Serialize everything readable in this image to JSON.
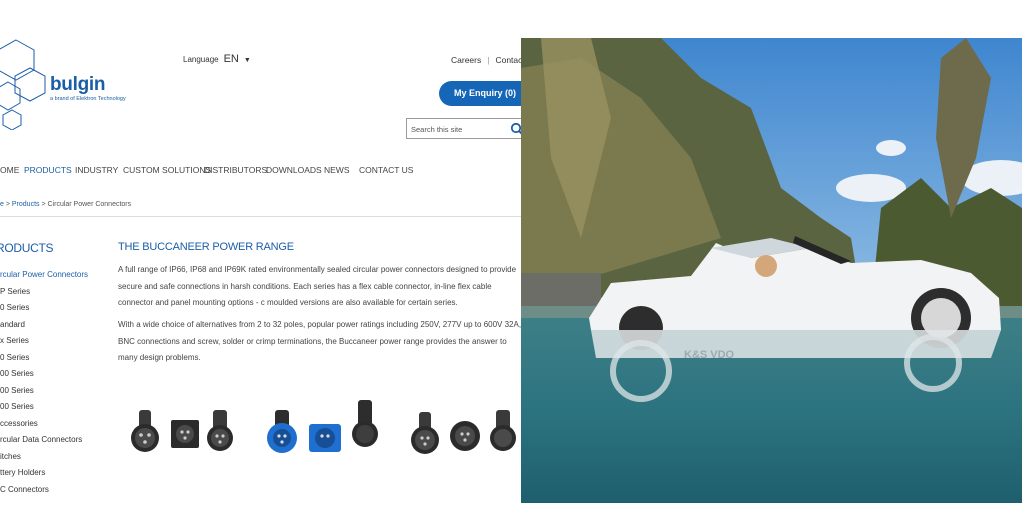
{
  "site": {
    "brand": {
      "name": "bulgin",
      "tagline": "a brand of Elektron Technology"
    },
    "language": {
      "label": "Language",
      "code": "EN"
    },
    "top_links": [
      "Careers",
      "Contact U"
    ],
    "enquiry_button": "My Enquiry (0)",
    "search_placeholder": "Search this site",
    "nav": [
      "OME",
      "PRODUCTS",
      "INDUSTRY",
      "CUSTOM SOLUTIONS",
      "DISTRIBUTORS",
      "DOWNLOADS",
      "NEWS",
      "CONTACT US"
    ],
    "nav_active_index": 1,
    "breadcrumb": {
      "home": "e",
      "sep1": " > ",
      "products": "Products",
      "sep2": " > ",
      "current": "Circular Power Connectors"
    },
    "sidebar": {
      "heading": "RODUCTS",
      "items": [
        "rcular Power Connectors",
        "P Series",
        "0 Series",
        "andard",
        "x Series",
        "0 Series",
        "00 Series",
        "00 Series",
        "00 Series",
        "ccessories",
        "rcular Data Connectors",
        "itches",
        "ttery Holders",
        "C Connectors"
      ],
      "active_index": 0
    },
    "content": {
      "title": "THE BUCCANEER POWER RANGE",
      "paragraph1": "A full range of IP66, IP68 and IP69K rated environmentally sealed circular power connectors designed to provide secure and safe connections in harsh conditions. Each series has a flex cable connector, in-line flex cable connector and panel mounting options - c moulded versions are also available for certain series.",
      "paragraph2": "With a wide choice of alternatives from 2 to 32 poles, popular power ratings including 250V, 277V up to 600V 32A, BNC connections and screw, solder or crimp terminations, the Buccaneer power range provides the answer to many design problems."
    }
  },
  "photo": {
    "car_logo": "K&S VDO"
  },
  "colors": {
    "brand_blue": "#1b5ea8",
    "button_blue": "#1566b7",
    "sky": "#4a90d4",
    "water": "#2f7886"
  }
}
